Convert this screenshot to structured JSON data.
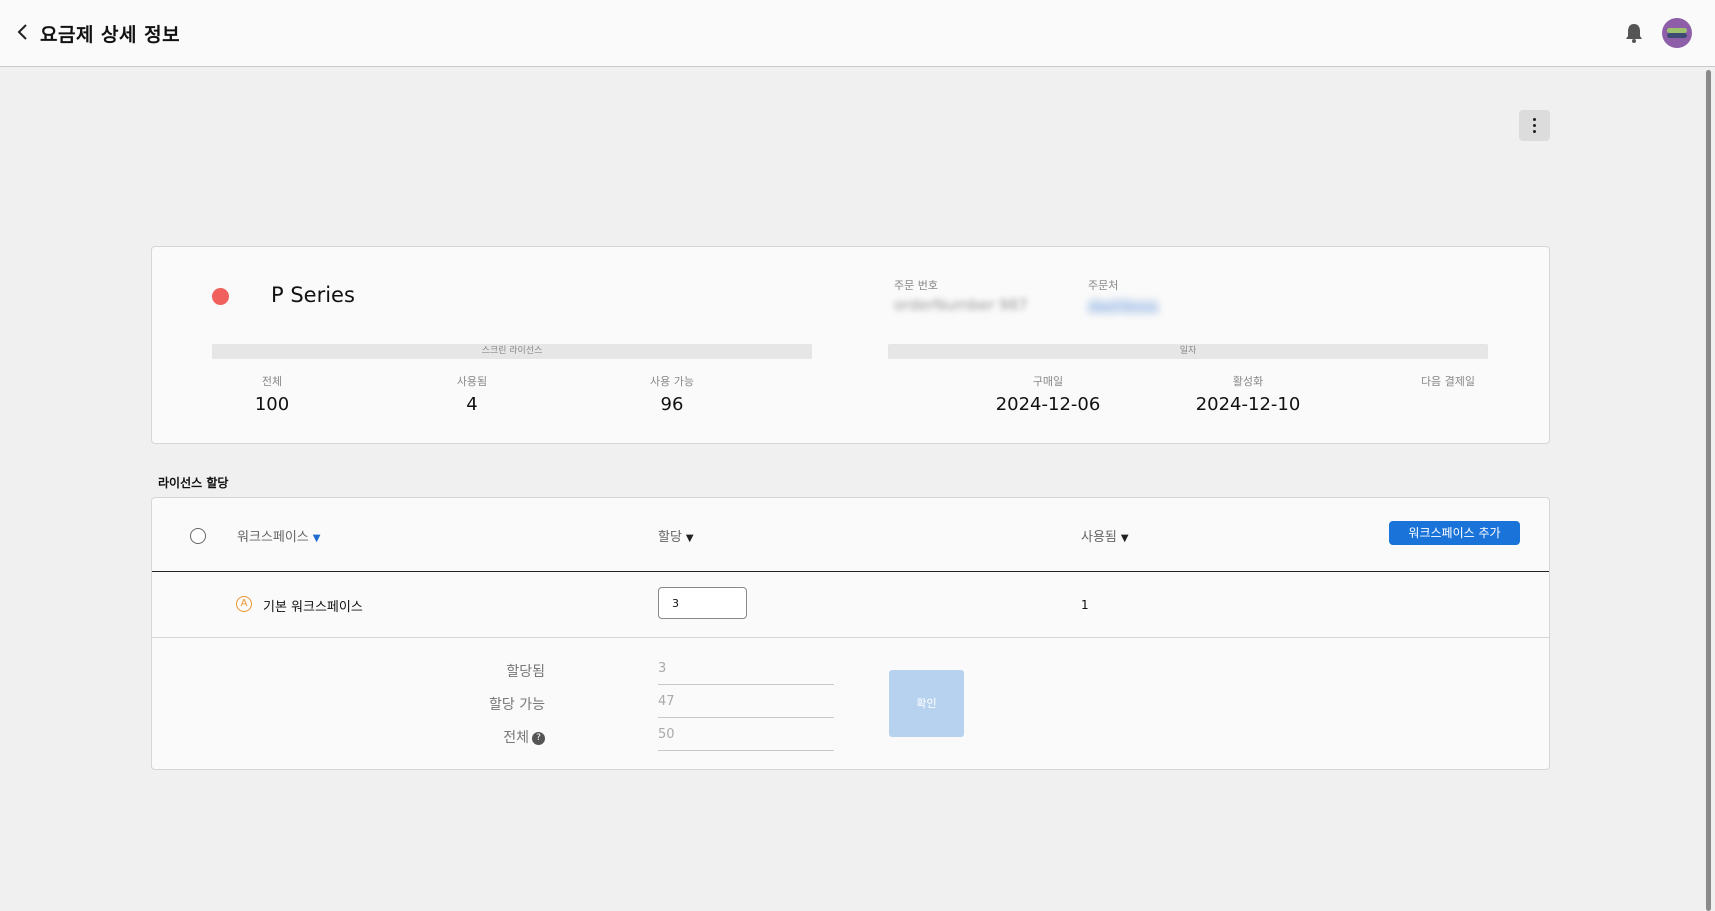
{
  "header": {
    "title": "요금제 상세 정보",
    "back_icon": "chevron-left-icon",
    "notification_icon": "bell-icon"
  },
  "plan": {
    "name": "P Series",
    "status_color": "#f0605d",
    "order_number_label": "주문 번호",
    "order_number_value": "orderNumber 987",
    "orderer_label": "주문처",
    "orderer_value": "dashboss",
    "license_section_label": "스크린 라이선스",
    "date_section_label": "일자",
    "stats": {
      "total_label": "전체",
      "total_value": "100",
      "used_label": "사용됨",
      "used_value": "4",
      "available_label": "사용 가능",
      "available_value": "96"
    },
    "dates": {
      "purchase_label": "구매일",
      "purchase_value": "2024-12-06",
      "activation_label": "활성화",
      "activation_value": "2024-12-10",
      "next_payment_label": "다음 결제일",
      "next_payment_value": ""
    }
  },
  "allocation": {
    "heading": "라이선스 할당",
    "columns": {
      "workspace": "워크스페이스",
      "allocation": "할당",
      "used": "사용됨"
    },
    "add_workspace_button": "워크스페이스 추가",
    "rows": [
      {
        "icon_letter": "A",
        "name": "기본 워크스페이스",
        "allocation": "3",
        "used": "1"
      }
    ],
    "summary": {
      "allocated_label": "할당됨",
      "allocated_value": "3",
      "allocatable_label": "할당 가능",
      "allocatable_value": "47",
      "total_label": "전체",
      "total_value": "50"
    },
    "confirm_button": "확인"
  },
  "colors": {
    "accent": "#1a73d9",
    "confirm_disabled": "#b7d2ee",
    "workspace_icon": "#e8952b"
  }
}
